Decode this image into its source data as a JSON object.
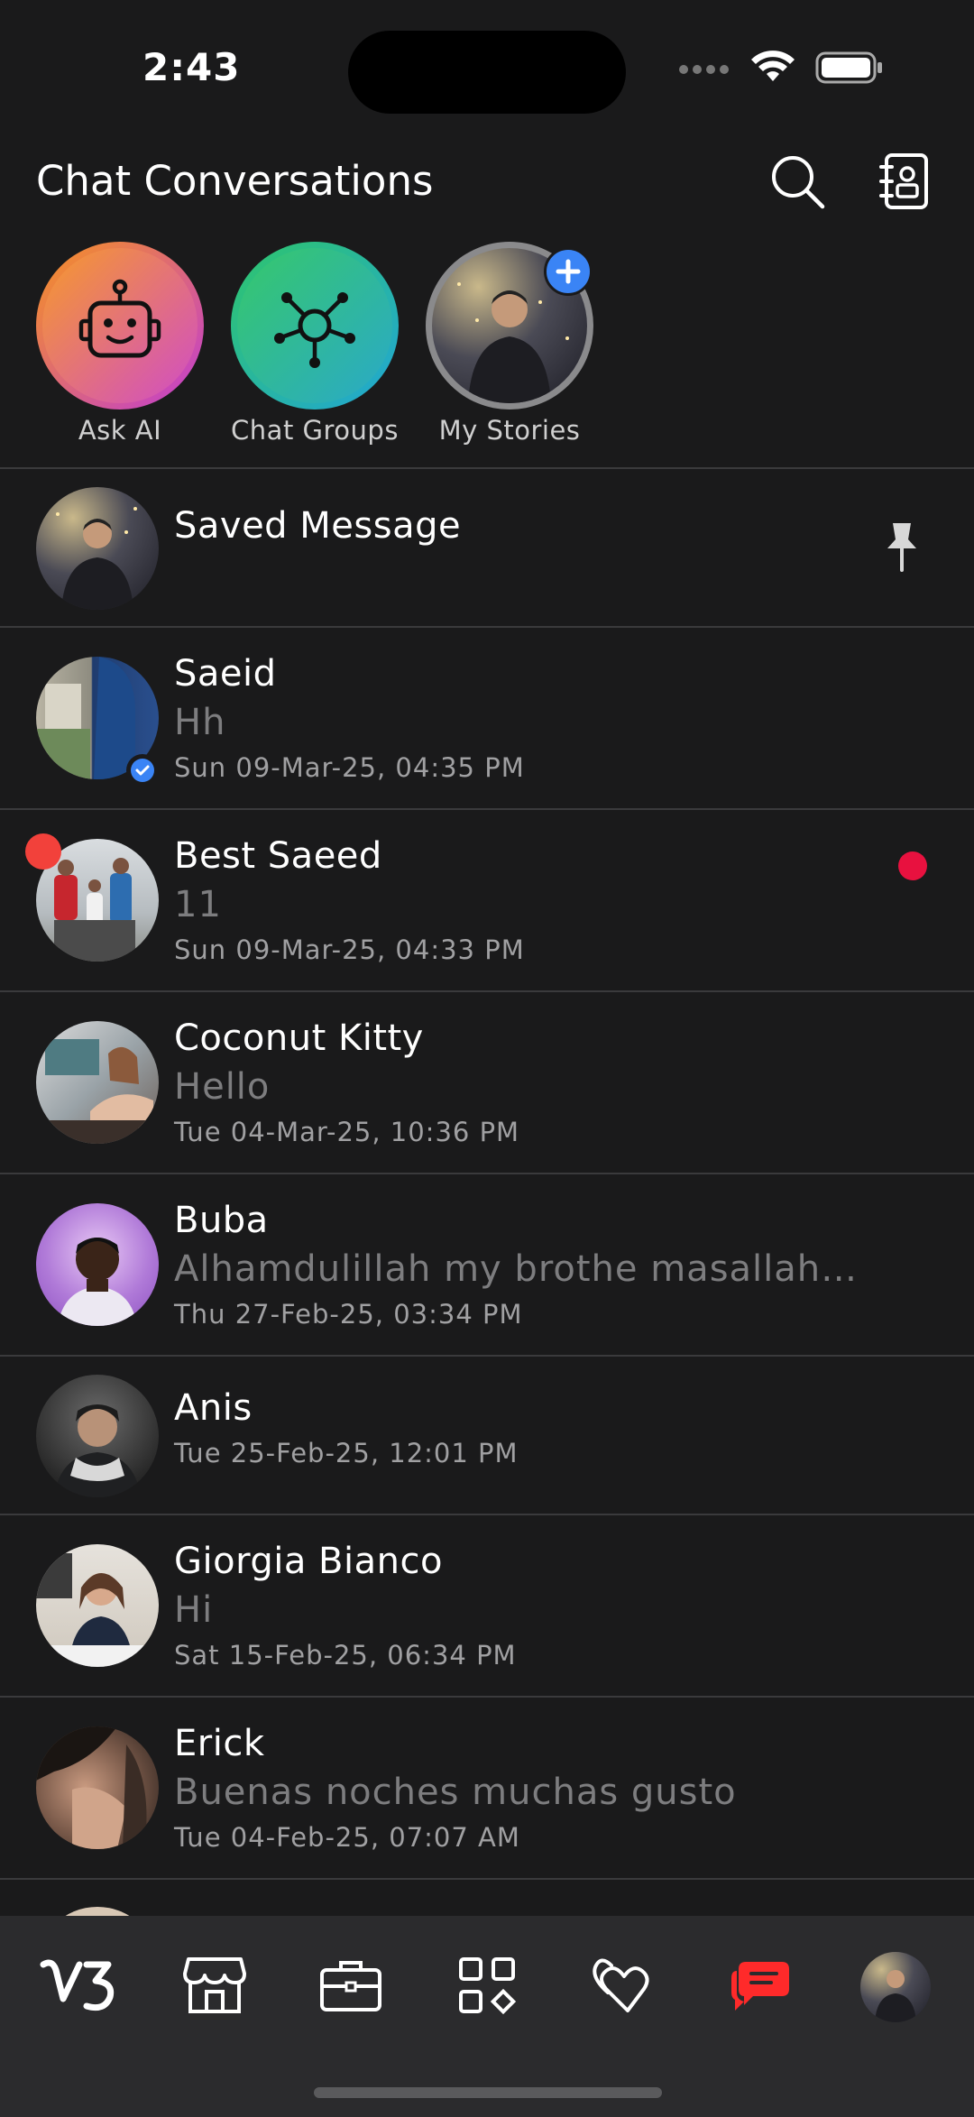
{
  "status_bar": {
    "time": "2:43"
  },
  "header": {
    "title": "Chat Conversations",
    "search_icon": "search-icon",
    "contacts_icon": "contacts-book-icon"
  },
  "stories": [
    {
      "label": "Ask AI",
      "icon": "robot-icon",
      "colors": [
        "#f7941d",
        "#c13bd6"
      ]
    },
    {
      "label": "Chat Groups",
      "icon": "network-hub-icon",
      "colors": [
        "#2fc56a",
        "#21a6d6"
      ]
    },
    {
      "label": "My Stories",
      "icon": "add-story-icon",
      "colors": [
        "#8a8a8c",
        "#8a8a8c"
      ]
    }
  ],
  "chats": [
    {
      "name": "Saved Message",
      "preview": "",
      "time": "",
      "pinned": true
    },
    {
      "name": "Saeid",
      "preview": "Hh",
      "time": "Sun 09-Mar-25, 04:35 PM",
      "verified": true
    },
    {
      "name": "Best Saeed",
      "preview": "11",
      "time": "Sun 09-Mar-25, 04:33 PM",
      "online": true,
      "unread": true
    },
    {
      "name": "Coconut Kitty",
      "preview": "Hello",
      "time": "Tue 04-Mar-25, 10:36 PM"
    },
    {
      "name": "Buba",
      "preview": "Alhamdulillah my brothe masallah l...",
      "time": "Thu 27-Feb-25, 03:34 PM"
    },
    {
      "name": "Anis",
      "preview": "",
      "time": "Tue 25-Feb-25, 12:01 PM"
    },
    {
      "name": "Giorgia Bianco",
      "preview": "Hi",
      "time": "Sat 15-Feb-25, 06:34 PM"
    },
    {
      "name": "Erick",
      "preview": "Buenas noches muchas gusto",
      "time": "Tue 04-Feb-25, 07:07 AM"
    }
  ],
  "tab_bar": {
    "items": [
      "app-logo-icon",
      "store-icon",
      "briefcase-icon",
      "apps-grid-icon",
      "hearts-icon",
      "chat-bubble-icon",
      "profile-avatar"
    ],
    "active": "chat-bubble-icon",
    "active_color": "#ff2a2a"
  },
  "colors": {
    "background": "#1a1a1b",
    "divider": "#3a3a3c",
    "accent_blue": "#3a84f5",
    "unread": "#e8113f"
  }
}
